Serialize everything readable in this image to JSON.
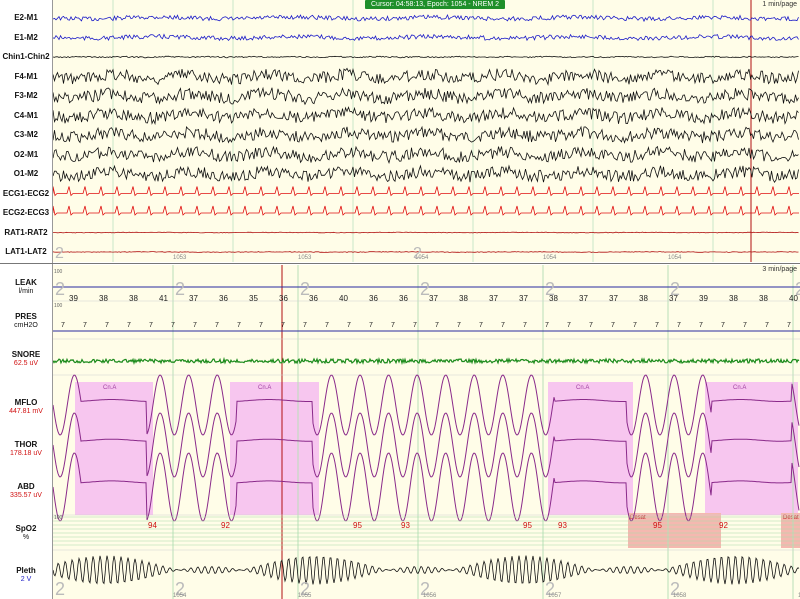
{
  "status_bar": "Cursor: 04:58:13, Epoch: 1054 - NREM 2",
  "top_scale": "1 min/page",
  "bottom_scale": "3 min/page",
  "top_channels": [
    {
      "label": "E2-M1",
      "color": "#1c1cc8",
      "amp": 2.2,
      "freq": 0.9
    },
    {
      "label": "E1-M2",
      "color": "#1c1cc8",
      "amp": 2.2,
      "freq": 0.9
    },
    {
      "label": "Chin1-Chin2",
      "color": "#111111",
      "amp": 0.6,
      "freq": 3
    },
    {
      "label": "F4-M1",
      "color": "#111111",
      "amp": 6,
      "freq": 1.6
    },
    {
      "label": "F3-M2",
      "color": "#111111",
      "amp": 6,
      "freq": 1.6
    },
    {
      "label": "C4-M1",
      "color": "#111111",
      "amp": 6,
      "freq": 1.6
    },
    {
      "label": "C3-M2",
      "color": "#111111",
      "amp": 6,
      "freq": 1.6
    },
    {
      "label": "O2-M1",
      "color": "#111111",
      "amp": 6,
      "freq": 1.6
    },
    {
      "label": "O1-M2",
      "color": "#111111",
      "amp": 6,
      "freq": 1.6
    },
    {
      "label": "ECG1-ECG2",
      "color": "#e01010",
      "amp": 0,
      "freq": 0,
      "ecg": true
    },
    {
      "label": "ECG2-ECG3",
      "color": "#e01010",
      "amp": 0,
      "freq": 0,
      "ecg": true
    },
    {
      "label": "RAT1-RAT2",
      "color": "#b01010",
      "amp": 0.3,
      "freq": 1
    },
    {
      "label": "LAT1-LAT2",
      "color": "#b01010",
      "amp": 0.3,
      "freq": 1
    }
  ],
  "epoch_labels": [
    "1053",
    "1053",
    "1054",
    "1054",
    "1054"
  ],
  "bottom_channels": {
    "leak": {
      "label": "LEAK",
      "unit": "l/min",
      "scale": "100",
      "values": [
        "39",
        "38",
        "38",
        "41",
        "37",
        "36",
        "35",
        "36",
        "36",
        "40",
        "36",
        "36",
        "37",
        "38",
        "37",
        "37",
        "38",
        "37",
        "37",
        "38",
        "37",
        "39",
        "38",
        "38",
        "40"
      ]
    },
    "pres": {
      "label": "PRES",
      "unit": "cmH2O",
      "scale": "100",
      "values": [
        "7",
        "7",
        "7",
        "7",
        "7",
        "7",
        "7",
        "7",
        "7",
        "7",
        "7",
        "7",
        "7",
        "7",
        "7",
        "7",
        "7",
        "7",
        "7",
        "7",
        "7",
        "7",
        "7",
        "7",
        "7",
        "7",
        "7",
        "7",
        "7",
        "7",
        "7",
        "7",
        "7",
        "7"
      ]
    },
    "snore": {
      "label": "SNORE",
      "value": "62.5 uV"
    },
    "mflo": {
      "label": "MFLO",
      "value": "447.81 mV"
    },
    "thor": {
      "label": "THOR",
      "value": "178.18 uV"
    },
    "abd": {
      "label": "ABD",
      "value": "335.57 uV"
    },
    "spo2": {
      "label": "SpO2",
      "unit": "%",
      "scale": "100",
      "values": [
        "94",
        "92",
        "95",
        "93",
        "95",
        "93",
        "95",
        "92"
      ]
    },
    "pleth": {
      "label": "Pleth",
      "value": "2 V"
    }
  },
  "event_tag": "Cn.A",
  "desat_tag": "Desat",
  "stage_marker": "2",
  "bottom_epochs": [
    "1054",
    "1055",
    "1056",
    "1057",
    "1058",
    "1059"
  ]
}
